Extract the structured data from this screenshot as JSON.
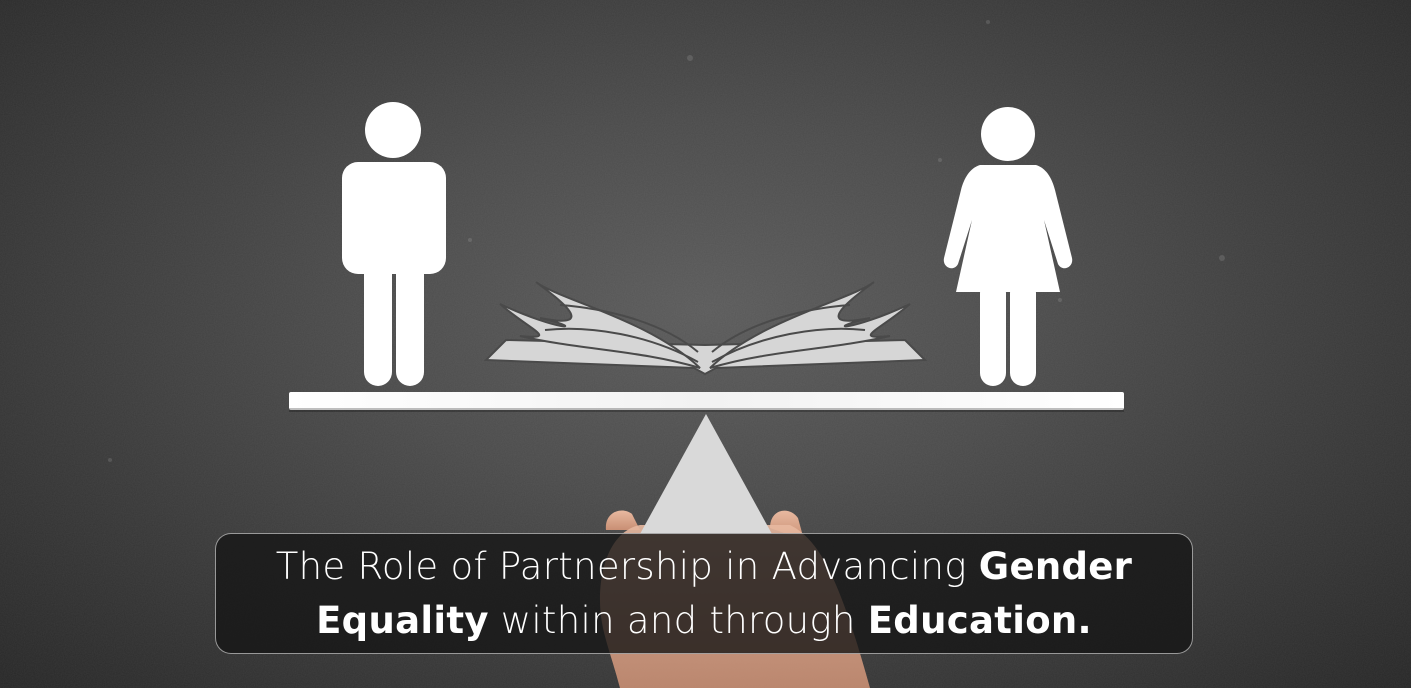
{
  "caption": {
    "part1": "The Role of Partnership in Advancing ",
    "bold1": "Gender Equality",
    "part2": " within and through ",
    "bold2": "Education."
  },
  "colors": {
    "chalkboard": "#4a4a4a",
    "figure": "#ffffff",
    "book": "#d6d6d6",
    "caption_bg": "#141414"
  },
  "icons": [
    "man-icon",
    "woman-icon",
    "open-book-icon",
    "balance-beam",
    "fulcrum-triangle",
    "hand"
  ]
}
